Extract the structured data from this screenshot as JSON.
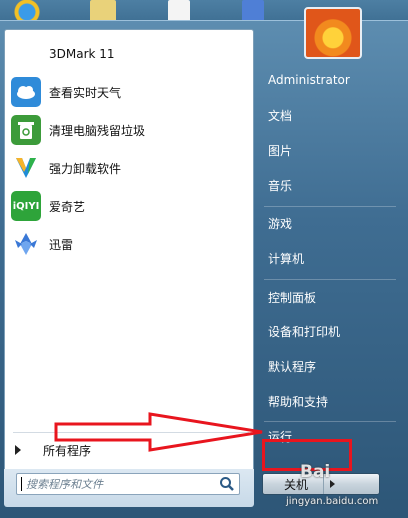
{
  "programs": [
    {
      "label": "3DMark 11",
      "icon": "3dmark-icon",
      "color": "#ffffff"
    },
    {
      "label": "查看实时天气",
      "icon": "weather-icon",
      "color": "#2f8bd9"
    },
    {
      "label": "清理电脑残留垃圾",
      "icon": "recycle-icon",
      "color": "#3c9b3a"
    },
    {
      "label": "强力卸载软件",
      "icon": "uninstall-shield-icon",
      "color": "#1f8cd6"
    },
    {
      "label": "爱奇艺",
      "icon": "iqiyi-icon",
      "color": "#2ea43a"
    },
    {
      "label": "迅雷",
      "icon": "xunlei-icon",
      "color": "#3a78d6"
    }
  ],
  "all_programs": "所有程序",
  "search": {
    "placeholder": "搜索程序和文件"
  },
  "right": {
    "user": "Administrator",
    "documents": "文档",
    "pictures": "图片",
    "music": "音乐",
    "games": "游戏",
    "computer": "计算机",
    "control_panel": "控制面板",
    "devices": "设备和打印机",
    "defaults": "默认程序",
    "help": "帮助和支持",
    "run": "运行..."
  },
  "shutdown": "关机",
  "watermark": {
    "main": "Bai",
    "sub": "jingyan.baidu.com"
  },
  "colors": {
    "annotation_red": "#e8151e",
    "menu_blue": "#3f6d92"
  }
}
